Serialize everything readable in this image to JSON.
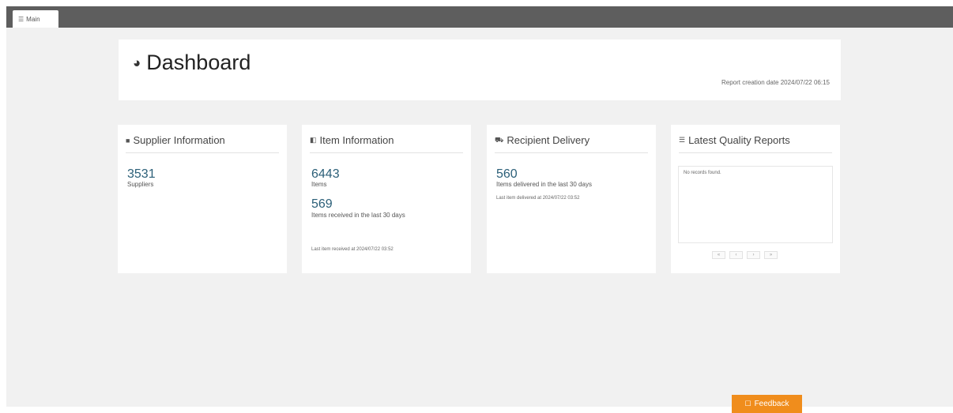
{
  "tab": {
    "label": "Main",
    "icon": "list-icon"
  },
  "header": {
    "title": "Dashboard",
    "icon": "dashboard-gauge-icon",
    "report_date": "Report creation date 2024/07/22 06:15"
  },
  "supplier": {
    "title": "Supplier Information",
    "icon": "building-icon",
    "count": "3531",
    "count_label": "Suppliers"
  },
  "item": {
    "title": "Item Information",
    "icon": "box-icon",
    "count": "6443",
    "count_label": "Items",
    "received_count": "569",
    "received_label": "Items received in the last 30 days",
    "last_received": "Last item received at 2024/07/22 03:52"
  },
  "recipient": {
    "title": "Recipient Delivery",
    "icon": "truck-icon",
    "count": "560",
    "count_label": "Items delivered in the last 30 days",
    "last_delivered": "Last item delivered at 2024/07/22 03:52"
  },
  "quality": {
    "title": "Latest Quality Reports",
    "icon": "list-icon",
    "empty_text": "No records found.",
    "pager": [
      "«",
      "‹",
      "›",
      "»"
    ]
  },
  "feedback": {
    "label": "Feedback",
    "icon": "comment-icon"
  },
  "colors": {
    "accent": "#2b5f78",
    "feedback": "#f08d1c",
    "topbar": "#5e5e5e"
  }
}
